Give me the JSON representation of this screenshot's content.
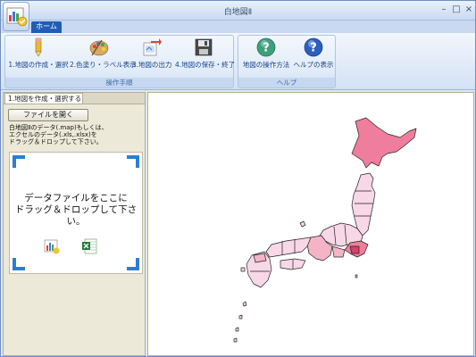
{
  "window": {
    "title": "白地図Ⅱ",
    "controls": [
      "–",
      "□",
      "×"
    ]
  },
  "tabs": [
    {
      "label": "ホーム"
    }
  ],
  "ribbon": {
    "groups": [
      {
        "label": "操作手順",
        "buttons": [
          {
            "label": "1.地図の作成・選択",
            "icon": "pencil-icon"
          },
          {
            "label": "2.色塗り・ラベル表示",
            "icon": "palette-icon"
          },
          {
            "label": "3.地図の出力",
            "icon": "export-icon"
          },
          {
            "label": "4.地図の保存・終了",
            "icon": "save-icon"
          }
        ]
      },
      {
        "label": "ヘルプ",
        "buttons": [
          {
            "label": "地図の操作方法",
            "icon": "help-icon"
          },
          {
            "label": "ヘルプの表示",
            "icon": "help-icon"
          }
        ]
      }
    ]
  },
  "panel": {
    "tab_label": "1.地図を作成・選択する",
    "open_button": "ファイルを開く",
    "instructions": [
      "白地図Ⅱのデータ(.map)もしくは、",
      "エクセルのデータ(.xls,.xlsx)を",
      "ドラッグ＆ドロップして下さい。"
    ],
    "drop_text": [
      "データファイルをここに",
      "ドラッグ＆ドロップして下さい。"
    ]
  },
  "map": {
    "colors": {
      "dark": "#ef7e9c",
      "medium": "#f5b3c6",
      "light": "#f8d7e7",
      "border": "#222222"
    }
  }
}
